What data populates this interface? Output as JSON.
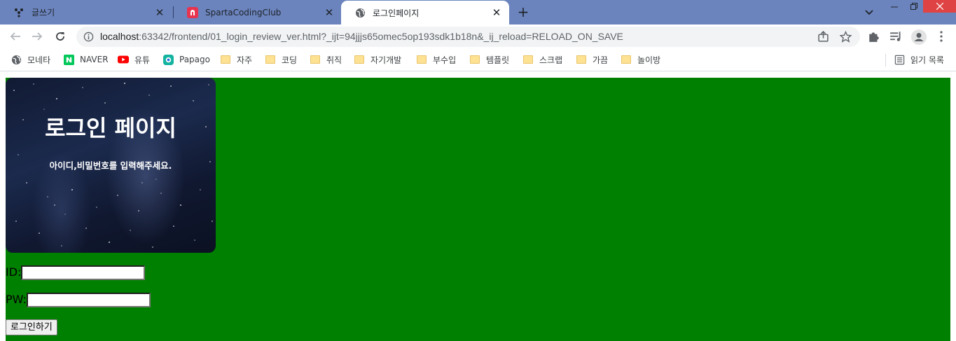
{
  "tabs": [
    {
      "title": "글쓰기",
      "icon": "dots-logo-icon",
      "active": false
    },
    {
      "title": "SpartaCodingClub",
      "icon": "sparta-logo-icon",
      "active": false
    },
    {
      "title": "로그인페이지",
      "icon": "globe-icon",
      "active": true
    }
  ],
  "address_bar": {
    "host": "localhost",
    "rest": ":63342/frontend/01_login_review_ver.html?_ijt=94jjjs65omec5op193sdk1b18n&_ij_reload=RELOAD_ON_SAVE"
  },
  "bookmarks": [
    {
      "label": "모네타",
      "icon": "globe-icon"
    },
    {
      "label": "NAVER",
      "icon": "naver-icon"
    },
    {
      "label": "유튜",
      "icon": "youtube-icon"
    },
    {
      "label": "Papago",
      "icon": "papago-icon"
    },
    {
      "label": "자주",
      "icon": "folder-icon"
    },
    {
      "label": "코딩",
      "icon": "folder-icon"
    },
    {
      "label": "취직",
      "icon": "folder-icon"
    },
    {
      "label": "자기개발",
      "icon": "folder-icon"
    },
    {
      "label": "부수입",
      "icon": "folder-icon"
    },
    {
      "label": "템플릿",
      "icon": "folder-icon"
    },
    {
      "label": "스크랩",
      "icon": "folder-icon"
    },
    {
      "label": "가끔",
      "icon": "folder-icon"
    },
    {
      "label": "놀이방",
      "icon": "folder-icon"
    }
  ],
  "reading_list": "읽기 목록",
  "page": {
    "title": "로그인 페이지",
    "subtitle": "아이디,비밀번호를 입력해주세요.",
    "id_label": "ID:",
    "id_value": "",
    "pw_label": "PW:",
    "pw_value": "",
    "login_button": "로그인하기"
  },
  "colors": {
    "tabstrip": "#6b84bd",
    "page_background": "#008000",
    "close_button": "#e04343"
  }
}
